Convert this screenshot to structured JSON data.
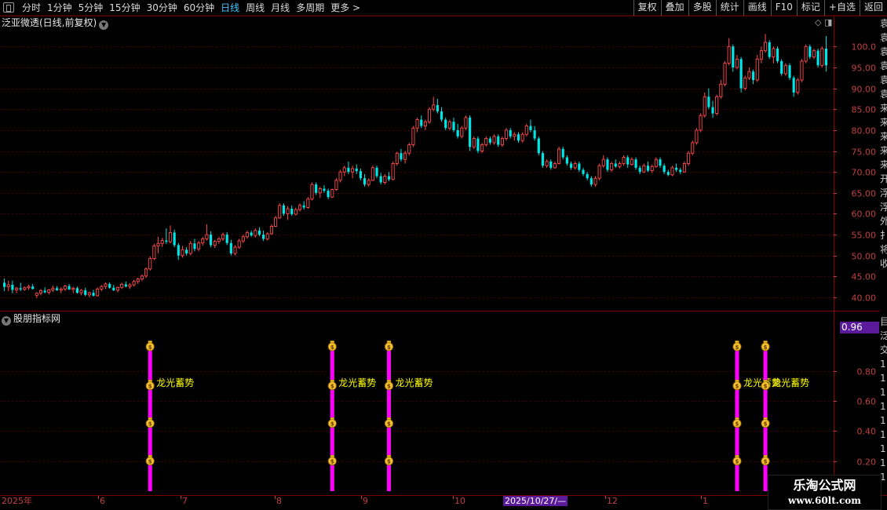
{
  "toolbar": {
    "periods": [
      "分时",
      "1分钟",
      "5分钟",
      "15分钟",
      "30分钟",
      "60分钟",
      "日线",
      "周线",
      "月线",
      "多周期",
      "更多 >"
    ],
    "active_period": "日线",
    "right_buttons": [
      "复权",
      "叠加",
      "多股",
      "统计",
      "画线",
      "F10",
      "标记",
      "+自选",
      "返回"
    ]
  },
  "price_panel": {
    "title": "泛亚微透(日线,前复权)",
    "corner_icons": [
      "diamond-icon",
      "window-icon"
    ]
  },
  "indicator_panel": {
    "title": "股朋指标网",
    "current_value": "0.96",
    "signal_label": "龙光蓄势"
  },
  "right_strip_chars": [
    "袁",
    "袁",
    "袁",
    "袁",
    "袁",
    "袁",
    "来",
    "来",
    "来",
    "来",
    "来",
    "开",
    "浮",
    "浮",
    "外",
    "扌",
    "将",
    "收"
  ],
  "right_strip_lower": [
    "目",
    "泛",
    "交",
    "1",
    "1",
    "1",
    "1",
    "1",
    "1",
    "1",
    "1",
    "1"
  ],
  "date_axis": {
    "labels": [
      "2025年",
      "6",
      "7",
      "8",
      "9",
      "10",
      "12",
      "1"
    ],
    "cursor_label": "2025/10/27/—"
  },
  "logo": {
    "line1": "乐淘公式网",
    "line2": "www.60lt.com"
  },
  "colors": {
    "up": "#ff4a4a",
    "down": "#00e5e5",
    "signal_bar": "#ff00ff",
    "label": "#ffff00",
    "axis": "#c04040",
    "grid": "#4a0000"
  },
  "chart_data": [
    {
      "type": "candlestick",
      "title": "泛亚微透(日线,前复权)",
      "ylim": [
        37,
        104
      ],
      "yticks": [
        40.0,
        45.0,
        50.0,
        55.0,
        60.0,
        65.0,
        70.0,
        75.0,
        80.0,
        85.0,
        90.0,
        95.0,
        100.0
      ],
      "ohlc": [
        [
          43.5,
          44.5,
          41.5,
          42.5
        ],
        [
          42.5,
          44,
          41.5,
          43
        ],
        [
          43,
          44,
          41,
          41.8
        ],
        [
          41.8,
          42.5,
          41,
          42.2
        ],
        [
          42.2,
          43.5,
          41.5,
          41.9
        ],
        [
          41.9,
          42.6,
          41.6,
          42.3
        ],
        [
          42.3,
          43,
          41.8,
          42.6
        ],
        [
          42.6,
          43.2,
          41.9,
          42
        ],
        [
          40.5,
          41.2,
          39.8,
          41
        ],
        [
          41,
          42,
          40.5,
          41.6
        ],
        [
          41.6,
          42.4,
          41,
          41.2
        ],
        [
          41.2,
          42,
          40.7,
          41.8
        ],
        [
          41.8,
          42.8,
          41.3,
          42.2
        ],
        [
          42.2,
          42.7,
          41.6,
          41.7
        ],
        [
          41.7,
          42.4,
          41,
          42
        ],
        [
          42,
          43,
          41.5,
          42.7
        ],
        [
          42.7,
          43.2,
          41.8,
          41.9
        ],
        [
          41.9,
          42.5,
          41,
          42.2
        ],
        [
          42.2,
          42.6,
          40.9,
          41.1
        ],
        [
          41.1,
          42,
          40.5,
          41.7
        ],
        [
          41.7,
          42.3,
          40.3,
          40.6
        ],
        [
          40.6,
          41.4,
          40,
          41.1
        ],
        [
          41.1,
          41.8,
          40.2,
          40.4
        ],
        [
          40.4,
          42.4,
          40.2,
          42
        ],
        [
          42,
          43,
          41.5,
          42.6
        ],
        [
          42.6,
          43.6,
          42,
          43.2
        ],
        [
          43.2,
          43.6,
          42.1,
          42.3
        ],
        [
          42.3,
          43,
          41.5,
          41.7
        ],
        [
          41.7,
          42.6,
          41.2,
          42.4
        ],
        [
          42.4,
          43.5,
          42,
          43.1
        ],
        [
          43.1,
          43.8,
          42.4,
          42.6
        ],
        [
          42.6,
          43.4,
          42,
          43
        ],
        [
          43,
          44.2,
          42.6,
          43.8
        ],
        [
          43.8,
          44.7,
          43.2,
          44.4
        ],
        [
          44.4,
          45.5,
          43.9,
          45.1
        ],
        [
          45.1,
          47.2,
          44.6,
          46.8
        ],
        [
          46.8,
          49.8,
          46.4,
          49.3
        ],
        [
          49.3,
          52.8,
          48.9,
          52.3
        ],
        [
          52.3,
          54.5,
          50.5,
          52.9
        ],
        [
          52.9,
          54.2,
          52.1,
          53.6
        ],
        [
          53.6,
          56.5,
          52.8,
          53.3
        ],
        [
          53.3,
          57.2,
          52.9,
          55.5
        ],
        [
          55.5,
          56.2,
          52,
          52.5
        ],
        [
          52.5,
          53,
          49,
          50
        ],
        [
          50,
          52.3,
          49.5,
          51.4
        ],
        [
          51.4,
          52,
          50,
          50.5
        ],
        [
          50.5,
          53.5,
          50,
          52.9
        ],
        [
          52.9,
          54,
          51,
          51.6
        ],
        [
          51.6,
          53.5,
          51,
          53
        ],
        [
          53,
          54.5,
          52.4,
          54
        ],
        [
          54,
          57.5,
          53.6,
          55
        ],
        [
          55,
          55.8,
          52,
          52.5
        ],
        [
          52.5,
          53.8,
          51.8,
          53.4
        ],
        [
          53.4,
          54.5,
          52.8,
          54
        ],
        [
          54,
          55.5,
          53.5,
          55
        ],
        [
          55,
          55.6,
          52.5,
          53
        ],
        [
          53,
          53.8,
          50,
          50.5
        ],
        [
          50.5,
          52.5,
          50,
          52
        ],
        [
          52,
          54,
          51.6,
          53.5
        ],
        [
          53.5,
          55,
          53,
          54.5
        ],
        [
          54.5,
          56,
          54,
          55.5
        ],
        [
          55.5,
          56,
          54.5,
          54.8
        ],
        [
          54.8,
          56.5,
          54.3,
          56
        ],
        [
          56,
          56.8,
          54.6,
          55
        ],
        [
          55,
          56,
          53.5,
          54
        ],
        [
          54,
          55.6,
          53.6,
          55.2
        ],
        [
          55.2,
          57.5,
          55,
          57
        ],
        [
          57,
          59.5,
          56.8,
          59
        ],
        [
          59,
          62.5,
          58.8,
          62
        ],
        [
          62,
          62.5,
          59.5,
          60
        ],
        [
          60,
          61.8,
          58.5,
          61.2
        ],
        [
          61.2,
          62,
          59.5,
          59.9
        ],
        [
          59.9,
          61.5,
          59.6,
          61
        ],
        [
          61,
          62.5,
          60.5,
          62
        ],
        [
          62,
          63,
          61,
          61.5
        ],
        [
          61.5,
          64,
          61.2,
          63.5
        ],
        [
          63.5,
          67.5,
          63.2,
          67
        ],
        [
          67,
          67.5,
          64.5,
          65
        ],
        [
          65,
          66.5,
          63.8,
          66
        ],
        [
          66,
          66.8,
          65,
          65.5
        ],
        [
          65.5,
          66,
          63.5,
          64
        ],
        [
          64,
          66,
          63.8,
          65.8
        ],
        [
          65.8,
          68.5,
          65.5,
          68
        ],
        [
          68,
          70.5,
          67.5,
          70
        ],
        [
          70,
          71.5,
          69,
          71
        ],
        [
          71,
          72.5,
          69.5,
          70
        ],
        [
          70,
          71.5,
          68.5,
          70.8
        ],
        [
          70.8,
          71.8,
          69.5,
          70.2
        ],
        [
          70.2,
          70.8,
          68,
          68.5
        ],
        [
          68.5,
          69.5,
          66.5,
          67
        ],
        [
          67,
          68.5,
          66.5,
          68
        ],
        [
          68,
          71.5,
          67.8,
          71
        ],
        [
          71,
          71.5,
          68.5,
          69
        ],
        [
          69,
          69.8,
          67,
          67.5
        ],
        [
          67.5,
          69.5,
          67,
          69
        ],
        [
          69,
          70,
          67.8,
          68.2
        ],
        [
          68.2,
          72.5,
          68,
          72
        ],
        [
          72,
          74.8,
          71.5,
          74.5
        ],
        [
          74.5,
          75.5,
          72.5,
          73
        ],
        [
          73,
          75,
          72,
          74.5
        ],
        [
          74.5,
          77,
          74,
          76.5
        ],
        [
          76.5,
          81,
          76,
          80.5
        ],
        [
          80.5,
          83,
          79.5,
          82.5
        ],
        [
          82.5,
          83.5,
          80.5,
          81
        ],
        [
          81,
          82.5,
          80,
          82
        ],
        [
          82,
          85.5,
          81.5,
          85
        ],
        [
          85,
          88,
          84.5,
          86
        ],
        [
          86,
          87.5,
          84,
          84.5
        ],
        [
          84.5,
          85.5,
          82,
          82.5
        ],
        [
          82.5,
          83,
          80,
          80.5
        ],
        [
          80.5,
          82.5,
          80,
          82
        ],
        [
          82,
          83,
          79.5,
          80
        ],
        [
          80,
          81.5,
          78,
          78.5
        ],
        [
          78.5,
          81,
          78,
          80.5
        ],
        [
          80.5,
          83.5,
          80,
          83
        ],
        [
          83,
          83.5,
          75,
          76
        ],
        [
          76,
          78.5,
          75.5,
          78
        ],
        [
          78,
          78.5,
          74.5,
          75
        ],
        [
          75,
          77,
          74.5,
          76.5
        ],
        [
          76.5,
          78.5,
          76,
          78
        ],
        [
          78,
          78.5,
          76.5,
          77
        ],
        [
          77,
          79,
          76.5,
          78.5
        ],
        [
          78.5,
          79,
          76,
          76.5
        ],
        [
          76.5,
          78.5,
          76,
          78
        ],
        [
          78,
          80.5,
          77.5,
          80
        ],
        [
          80,
          80.5,
          78,
          78.5
        ],
        [
          78.5,
          79.5,
          77.5,
          79
        ],
        [
          79,
          79.5,
          77,
          77.5
        ],
        [
          77.5,
          79.5,
          77,
          79
        ],
        [
          79,
          81.5,
          78.5,
          81
        ],
        [
          81,
          82.5,
          79.5,
          80
        ],
        [
          80,
          81,
          77.5,
          78
        ],
        [
          78,
          78.5,
          74,
          74.5
        ],
        [
          74.5,
          75,
          71,
          71.5
        ],
        [
          71.5,
          73,
          71,
          72.5
        ],
        [
          72.5,
          73,
          70.5,
          71
        ],
        [
          71,
          72.5,
          70.8,
          72
        ],
        [
          72,
          76,
          71.8,
          75.5
        ],
        [
          75.5,
          76,
          73,
          73.5
        ],
        [
          73.5,
          74,
          71.5,
          72
        ],
        [
          72,
          72.5,
          70.5,
          71
        ],
        [
          71,
          72.5,
          70.5,
          72
        ],
        [
          72,
          72.5,
          70,
          70.5
        ],
        [
          70.5,
          71,
          69,
          69.5
        ],
        [
          69.5,
          70,
          68,
          68.5
        ],
        [
          68.5,
          69,
          66.5,
          67
        ],
        [
          67,
          69,
          66.5,
          68.5
        ],
        [
          68.5,
          72,
          68,
          71.5
        ],
        [
          71.5,
          74,
          71,
          73
        ],
        [
          73,
          73.5,
          70,
          70.5
        ],
        [
          70.5,
          72.5,
          70,
          72
        ],
        [
          72,
          73,
          71,
          71.3
        ],
        [
          71.3,
          72.5,
          70.8,
          72
        ],
        [
          72,
          74,
          71.5,
          73.5
        ],
        [
          73.5,
          74,
          71,
          71.8
        ],
        [
          71.8,
          73.5,
          71.5,
          73
        ],
        [
          73,
          73.5,
          70.5,
          71
        ],
        [
          71,
          71.5,
          69.5,
          70
        ],
        [
          70,
          72,
          69.8,
          71.5
        ],
        [
          71.5,
          72.5,
          70,
          70.3
        ],
        [
          70.3,
          71.8,
          69.8,
          71.3
        ],
        [
          71.3,
          73.5,
          71,
          73
        ],
        [
          73,
          73.5,
          71,
          71.5
        ],
        [
          71.5,
          72,
          69.5,
          70
        ],
        [
          70,
          70.5,
          69,
          69.3
        ],
        [
          69.3,
          71.5,
          69,
          71
        ],
        [
          71,
          72,
          70,
          70.5
        ],
        [
          70.5,
          71,
          69.5,
          70
        ],
        [
          70,
          72.5,
          69.8,
          72
        ],
        [
          72,
          75,
          71.5,
          74.5
        ],
        [
          74.5,
          77.5,
          74,
          77
        ],
        [
          77,
          80.5,
          76.5,
          80
        ],
        [
          80,
          84,
          79.5,
          83.5
        ],
        [
          83.5,
          89,
          83,
          88
        ],
        [
          88,
          90,
          85,
          85.5
        ],
        [
          85.5,
          87,
          83,
          84
        ],
        [
          84,
          88.5,
          83.5,
          88
        ],
        [
          88,
          92,
          87.5,
          91
        ],
        [
          91,
          96.5,
          90.5,
          96
        ],
        [
          96,
          102,
          95.5,
          100
        ],
        [
          100,
          100.5,
          94,
          95
        ],
        [
          95,
          98,
          94.5,
          97
        ],
        [
          97,
          97.5,
          89,
          90
        ],
        [
          90,
          93,
          89.5,
          92.5
        ],
        [
          92.5,
          95,
          92,
          94
        ],
        [
          94,
          94.5,
          91,
          92
        ],
        [
          92,
          98,
          91.5,
          97
        ],
        [
          97,
          100,
          96,
          99
        ],
        [
          99,
          103,
          98.5,
          101
        ],
        [
          101,
          101.5,
          97,
          97.5
        ],
        [
          97.5,
          100,
          96,
          99.5
        ],
        [
          99.5,
          100,
          96,
          96.5
        ],
        [
          96.5,
          97,
          93,
          93.5
        ],
        [
          93.5,
          96,
          93,
          95.5
        ],
        [
          95.5,
          96,
          92,
          92.5
        ],
        [
          92.5,
          93,
          88,
          89
        ],
        [
          89,
          92.5,
          88.5,
          92
        ],
        [
          92,
          97,
          91.5,
          96.5
        ],
        [
          96.5,
          100.5,
          96,
          100
        ],
        [
          100,
          100.5,
          97,
          97.5
        ],
        [
          97.5,
          99.5,
          97,
          99
        ],
        [
          99,
          99.5,
          95,
          95.5
        ],
        [
          95.5,
          100,
          95,
          99.5
        ],
        [
          99.5,
          102.5,
          94,
          95.5
        ]
      ]
    },
    {
      "type": "bar",
      "title": "股朋指标网",
      "ylim": [
        0,
        1.1
      ],
      "yticks": [
        0.2,
        0.4,
        0.6,
        0.8
      ],
      "signal_indices": [
        36,
        81,
        95,
        181,
        188
      ],
      "signal_value": 1.0,
      "marker_levels": [
        0.2,
        0.45,
        0.7,
        0.96
      ],
      "label_level": 0.72,
      "label": "龙光蓄势"
    }
  ]
}
